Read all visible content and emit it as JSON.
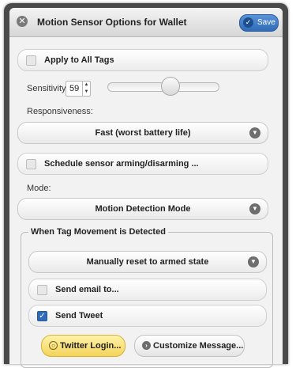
{
  "dialog": {
    "title": "Motion Sensor Options for Wallet",
    "save_label": "Save"
  },
  "apply_all": {
    "label": "Apply to All Tags",
    "checked": false
  },
  "sensitivity": {
    "label": "Sensitivity:",
    "value": "59",
    "level": 59
  },
  "responsiveness": {
    "label": "Responsiveness:",
    "selected": "Fast (worst battery life)"
  },
  "schedule": {
    "label": "Schedule sensor arming/disarming ...",
    "checked": false
  },
  "mode": {
    "label": "Mode:",
    "selected": "Motion Detection Mode"
  },
  "movement_group": {
    "legend": "When Tag Movement is Detected",
    "reset_selected": "Manually reset to armed state",
    "send_email": {
      "label": "Send email to...",
      "checked": false
    },
    "send_tweet": {
      "label": "Send Tweet",
      "checked": true
    },
    "twitter_login_label": "Twitter Login...",
    "customize_label": "Customize Message..."
  },
  "icons": {
    "close": "close-icon",
    "save": "check-circle-icon",
    "chevron": "chevron-down-icon",
    "twitter": "circle-icon",
    "customize": "arrow-right-circle-icon"
  },
  "colors": {
    "save_button": "#3a78c4",
    "twitter_button": "#f3d35a",
    "checkbox_checked": "#2f6bb8"
  }
}
